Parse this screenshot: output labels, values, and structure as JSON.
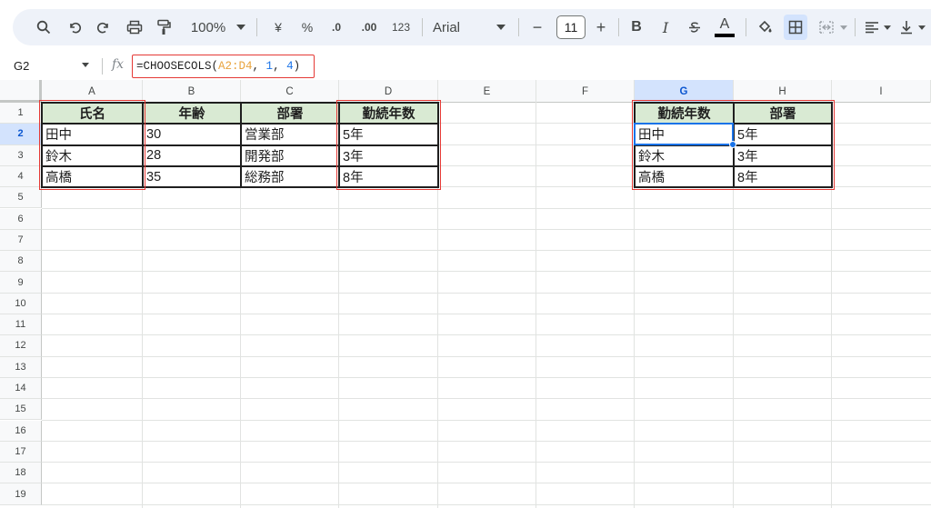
{
  "toolbar": {
    "zoom": "100%",
    "currency": "¥",
    "percent": "%",
    "dec_decrease": ".0",
    "dec_increase": ".00",
    "number_format": "123",
    "font": "Arial",
    "font_size": "11",
    "minus": "−",
    "plus": "+",
    "bold": "B",
    "italic": "I",
    "text_color_letter": "A"
  },
  "formula_bar": {
    "cell_ref": "G2",
    "fx": "fx",
    "formula_prefix": "=CHOOSECOLS(",
    "formula_range": "A2:D4",
    "formula_sep1": ", ",
    "formula_arg1": "1",
    "formula_sep2": ", ",
    "formula_arg2": "4",
    "formula_suffix": ")"
  },
  "columns": [
    "A",
    "B",
    "C",
    "D",
    "E",
    "F",
    "G",
    "H",
    "I"
  ],
  "rows": [
    "1",
    "2",
    "3",
    "4",
    "5",
    "6",
    "7",
    "8",
    "9",
    "10",
    "11",
    "12",
    "13",
    "14",
    "15",
    "16",
    "17",
    "18",
    "19"
  ],
  "selected_column": "G",
  "selected_row": "2",
  "source_table": {
    "headers": [
      "氏名",
      "年齢",
      "部署",
      "勤続年数"
    ],
    "rows": [
      [
        "田中",
        "30",
        "営業部",
        "5年"
      ],
      [
        "鈴木",
        "28",
        "開発部",
        "3年"
      ],
      [
        "高橋",
        "35",
        "総務部",
        "8年"
      ]
    ]
  },
  "result_table": {
    "headers": [
      "勤続年数",
      "部署"
    ],
    "rows": [
      [
        "田中",
        "5年"
      ],
      [
        "鈴木",
        "3年"
      ],
      [
        "高橋",
        "8年"
      ]
    ]
  },
  "colors": {
    "header_fill": "#d9ead3",
    "highlight_red": "#e53935",
    "selection_blue": "#1a73e8"
  }
}
